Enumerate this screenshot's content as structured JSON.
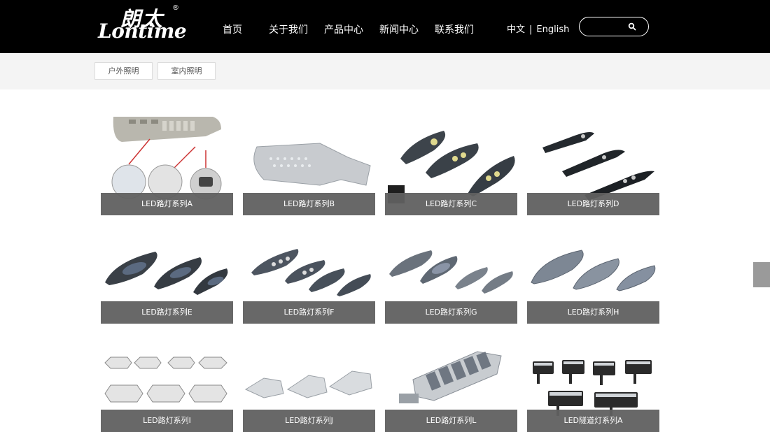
{
  "brand": {
    "name_cn": "朗太",
    "name_en": "Lontime",
    "registered": "®"
  },
  "nav": {
    "items": [
      "首页",
      "关于我们",
      "产品中心",
      "新闻中心",
      "联系我们"
    ]
  },
  "language": {
    "chinese": "中文",
    "separator": "|",
    "english": "English"
  },
  "search": {
    "placeholder": "",
    "value": ""
  },
  "categories": [
    "户外照明",
    "室内照明"
  ],
  "products": [
    {
      "label": "LED路灯系列A"
    },
    {
      "label": "LED路灯系列B"
    },
    {
      "label": "LED路灯系列C"
    },
    {
      "label": "LED路灯系列D"
    },
    {
      "label": "LED路灯系列E"
    },
    {
      "label": "LED路灯系列F"
    },
    {
      "label": "LED路灯系列G"
    },
    {
      "label": "LED路灯系列H"
    },
    {
      "label": "LED路灯系列I"
    },
    {
      "label": "LED路灯系列J"
    },
    {
      "label": "LED路灯系列L"
    },
    {
      "label": "LED隧道灯系列A"
    }
  ],
  "colors": {
    "header_bg": "#000000",
    "caption_bg": "#606060",
    "category_bar_bg": "#f4f4f4"
  }
}
